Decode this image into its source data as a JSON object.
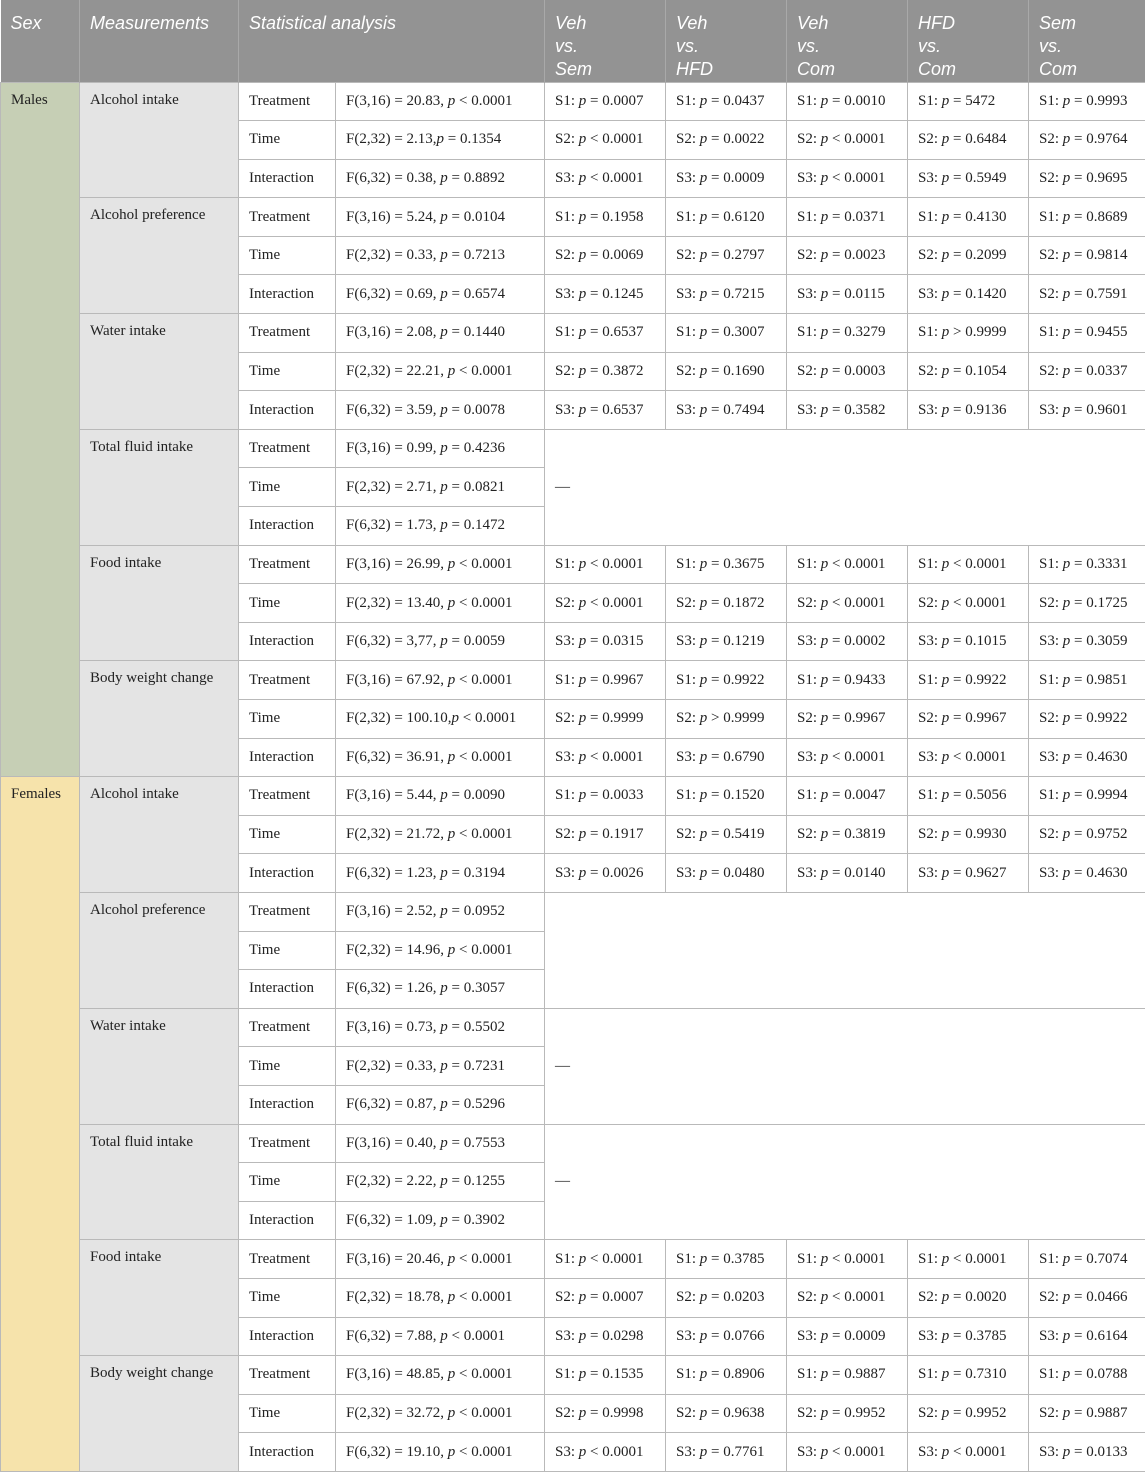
{
  "columns": [
    "Sex",
    "Measurements",
    "Statistical analysis",
    "Veh vs. Sem",
    "Veh vs. HFD",
    "Veh vs. Com",
    "HFD vs. Com",
    "Sem vs. Com"
  ],
  "groups": [
    {
      "sex": "Males",
      "measurements": [
        {
          "name": "Alcohol intake",
          "rows": [
            {
              "effect": "Treatment",
              "stat": "F(3,16) = 20.83, p < 0.0001",
              "c": [
                "S1: p = 0.0007",
                "S1: p = 0.0437",
                "S1: p = 0.0010",
                "S1: p = 5472",
                "S1: p = 0.9993"
              ]
            },
            {
              "effect": "Time",
              "stat": "F(2,32) = 2.13,p = 0.1354",
              "c": [
                "S2: p < 0.0001",
                "S2: p = 0.0022",
                "S2: p < 0.0001",
                "S2: p = 0.6484",
                "S2: p = 0.9764"
              ]
            },
            {
              "effect": "Interaction",
              "stat": "F(6,32) = 0.38, p = 0.8892",
              "c": [
                "S3: p < 0.0001",
                "S3: p = 0.0009",
                "S3: p < 0.0001",
                "S3: p = 0.5949",
                "S2: p = 0.9695"
              ]
            }
          ]
        },
        {
          "name": "Alcohol preference",
          "rows": [
            {
              "effect": "Treatment",
              "stat": "F(3,16) = 5.24, p = 0.0104",
              "c": [
                "S1: p = 0.1958",
                "S1: p = 0.6120",
                "S1: p = 0.0371",
                "S1: p = 0.4130",
                "S1: p = 0.8689"
              ]
            },
            {
              "effect": "Time",
              "stat": "F(2,32) = 0.33, p = 0.7213",
              "c": [
                "S2: p = 0.0069",
                "S2: p = 0.2797",
                "S2: p = 0.0023",
                "S2: p = 0.2099",
                "S2: p = 0.9814"
              ]
            },
            {
              "effect": "Interaction",
              "stat": "F(6,32) = 0.69, p = 0.6574",
              "c": [
                "S3: p = 0.1245",
                "S3: p = 0.7215",
                "S3: p = 0.0115",
                "S3: p = 0.1420",
                "S2: p = 0.7591"
              ]
            }
          ]
        },
        {
          "name": "Water intake",
          "rows": [
            {
              "effect": "Treatment",
              "stat": "F(3,16) = 2.08, p = 0.1440",
              "c": [
                "S1: p = 0.6537",
                "S1: p = 0.3007",
                "S1: p = 0.3279",
                "S1: p > 0.9999",
                "S1: p = 0.9455"
              ]
            },
            {
              "effect": "Time",
              "stat": "F(2,32) = 22.21, p < 0.0001",
              "c": [
                "S2: p = 0.3872",
                "S2: p = 0.1690",
                "S2: p = 0.0003",
                "S2: p = 0.1054",
                "S2: p = 0.0337"
              ]
            },
            {
              "effect": "Interaction",
              "stat": "F(6,32) = 3.59, p = 0.0078",
              "c": [
                "S3: p = 0.6537",
                "S3: p = 0.7494",
                "S3: p = 0.3582",
                "S3: p = 0.9136",
                "S3: p = 0.9601"
              ]
            }
          ]
        },
        {
          "name": "Total fluid intake",
          "dash": "—",
          "rows": [
            {
              "effect": "Treatment",
              "stat": "F(3,16) = 0.99, p = 0.4236"
            },
            {
              "effect": "Time",
              "stat": "F(2,32) = 2.71, p = 0.0821"
            },
            {
              "effect": "Interaction",
              "stat": "F(6,32) = 1.73, p = 0.1472"
            }
          ]
        },
        {
          "name": "Food intake",
          "rows": [
            {
              "effect": "Treatment",
              "stat": "F(3,16) = 26.99, p < 0.0001",
              "c": [
                "S1: p < 0.0001",
                "S1: p = 0.3675",
                "S1: p < 0.0001",
                "S1: p < 0.0001",
                "S1: p = 0.3331"
              ]
            },
            {
              "effect": "Time",
              "stat": "F(2,32) = 13.40, p < 0.0001",
              "c": [
                "S2: p < 0.0001",
                "S2: p = 0.1872",
                "S2: p < 0.0001",
                "S2: p < 0.0001",
                "S2: p = 0.1725"
              ]
            },
            {
              "effect": "Interaction",
              "stat": "F(6,32) = 3,77, p = 0.0059",
              "c": [
                "S3: p = 0.0315",
                "S3: p = 0.1219",
                "S3: p = 0.0002",
                "S3: p = 0.1015",
                "S3: p = 0.3059"
              ]
            }
          ]
        },
        {
          "name": "Body weight change",
          "rows": [
            {
              "effect": "Treatment",
              "stat": "F(3,16) = 67.92, p < 0.0001",
              "c": [
                "S1: p = 0.9967",
                "S1: p = 0.9922",
                "S1: p = 0.9433",
                "S1: p = 0.9922",
                "S1: p = 0.9851"
              ]
            },
            {
              "effect": "Time",
              "stat": "F(2,32) = 100.10,p < 0.0001",
              "c": [
                "S2: p = 0.9999",
                "S2: p > 0.9999",
                "S2: p = 0.9967",
                "S2: p = 0.9967",
                "S2: p = 0.9922"
              ]
            },
            {
              "effect": "Interaction",
              "stat": "F(6,32) = 36.91, p < 0.0001",
              "c": [
                "S3: p < 0.0001",
                "S3: p = 0.6790",
                "S3: p < 0.0001",
                "S3: p < 0.0001",
                "S3: p = 0.4630"
              ]
            }
          ]
        }
      ]
    },
    {
      "sex": "Females",
      "measurements": [
        {
          "name": "Alcohol intake",
          "rows": [
            {
              "effect": "Treatment",
              "stat": "F(3,16) = 5.44, p = 0.0090",
              "c": [
                "S1: p = 0.0033",
                "S1: p = 0.1520",
                "S1: p = 0.0047",
                "S1: p = 0.5056",
                "S1: p = 0.9994"
              ]
            },
            {
              "effect": "Time",
              "stat": "F(2,32) = 21.72, p < 0.0001",
              "c": [
                "S2: p = 0.1917",
                "S2: p = 0.5419",
                "S2: p = 0.3819",
                "S2: p = 0.9930",
                "S2: p = 0.9752"
              ]
            },
            {
              "effect": "Interaction",
              "stat": "F(6,32) = 1.23, p = 0.3194",
              "c": [
                "S3: p = 0.0026",
                "S3: p = 0.0480",
                "S3: p = 0.0140",
                "S3: p = 0.9627",
                "S3: p = 0.4630"
              ]
            }
          ]
        },
        {
          "name": "Alcohol preference",
          "dash": "",
          "rows": [
            {
              "effect": "Treatment",
              "stat": "F(3,16) = 2.52, p = 0.0952"
            },
            {
              "effect": "Time",
              "stat": "F(2,32) = 14.96, p < 0.0001"
            },
            {
              "effect": "Interaction",
              "stat": "F(6,32) = 1.26, p = 0.3057"
            }
          ]
        },
        {
          "name": "Water intake",
          "dash": "—",
          "rows": [
            {
              "effect": "Treatment",
              "stat": "F(3,16) = 0.73, p = 0.5502"
            },
            {
              "effect": "Time",
              "stat": "F(2,32) = 0.33, p = 0.7231"
            },
            {
              "effect": "Interaction",
              "stat": "F(6,32) = 0.87, p = 0.5296"
            }
          ]
        },
        {
          "name": "Total fluid intake",
          "dash": "—",
          "rows": [
            {
              "effect": "Treatment",
              "stat": "F(3,16) = 0.40, p = 0.7553"
            },
            {
              "effect": "Time",
              "stat": "F(2,32) = 2.22, p = 0.1255"
            },
            {
              "effect": "Interaction",
              "stat": "F(6,32) = 1.09, p = 0.3902"
            }
          ]
        },
        {
          "name": "Food intake",
          "rows": [
            {
              "effect": "Treatment",
              "stat": "F(3,16) = 20.46, p < 0.0001",
              "c": [
                "S1: p < 0.0001",
                "S1: p = 0.3785",
                "S1: p < 0.0001",
                "S1: p < 0.0001",
                "S1: p = 0.7074"
              ]
            },
            {
              "effect": "Time",
              "stat": "F(2,32) = 18.78, p < 0.0001",
              "c": [
                "S2: p = 0.0007",
                "S2: p = 0.0203",
                "S2: p < 0.0001",
                "S2: p = 0.0020",
                "S2: p = 0.0466"
              ]
            },
            {
              "effect": "Interaction",
              "stat": "F(6,32) = 7.88, p < 0.0001",
              "c": [
                "S3: p = 0.0298",
                "S3: p = 0.0766",
                "S3: p = 0.0009",
                "S3: p = 0.3785",
                "S3: p = 0.6164"
              ]
            }
          ]
        },
        {
          "name": "Body weight change",
          "rows": [
            {
              "effect": "Treatment",
              "stat": "F(3,16) = 48.85, p < 0.0001",
              "c": [
                "S1: p = 0.1535",
                "S1: p = 0.8906",
                "S1: p = 0.9887",
                "S1: p = 0.7310",
                "S1: p = 0.0788"
              ]
            },
            {
              "effect": "Time",
              "stat": "F(2,32) = 32.72, p < 0.0001",
              "c": [
                "S2: p = 0.9998",
                "S2: p = 0.9638",
                "S2: p = 0.9952",
                "S2: p = 0.9952",
                "S2: p = 0.9887"
              ]
            },
            {
              "effect": "Interaction",
              "stat": "F(6,32) = 19.10, p < 0.0001",
              "c": [
                "S3: p < 0.0001",
                "S3: p = 0.7761",
                "S3: p < 0.0001",
                "S3: p < 0.0001",
                "S3: p = 0.0133"
              ]
            }
          ]
        }
      ]
    }
  ]
}
